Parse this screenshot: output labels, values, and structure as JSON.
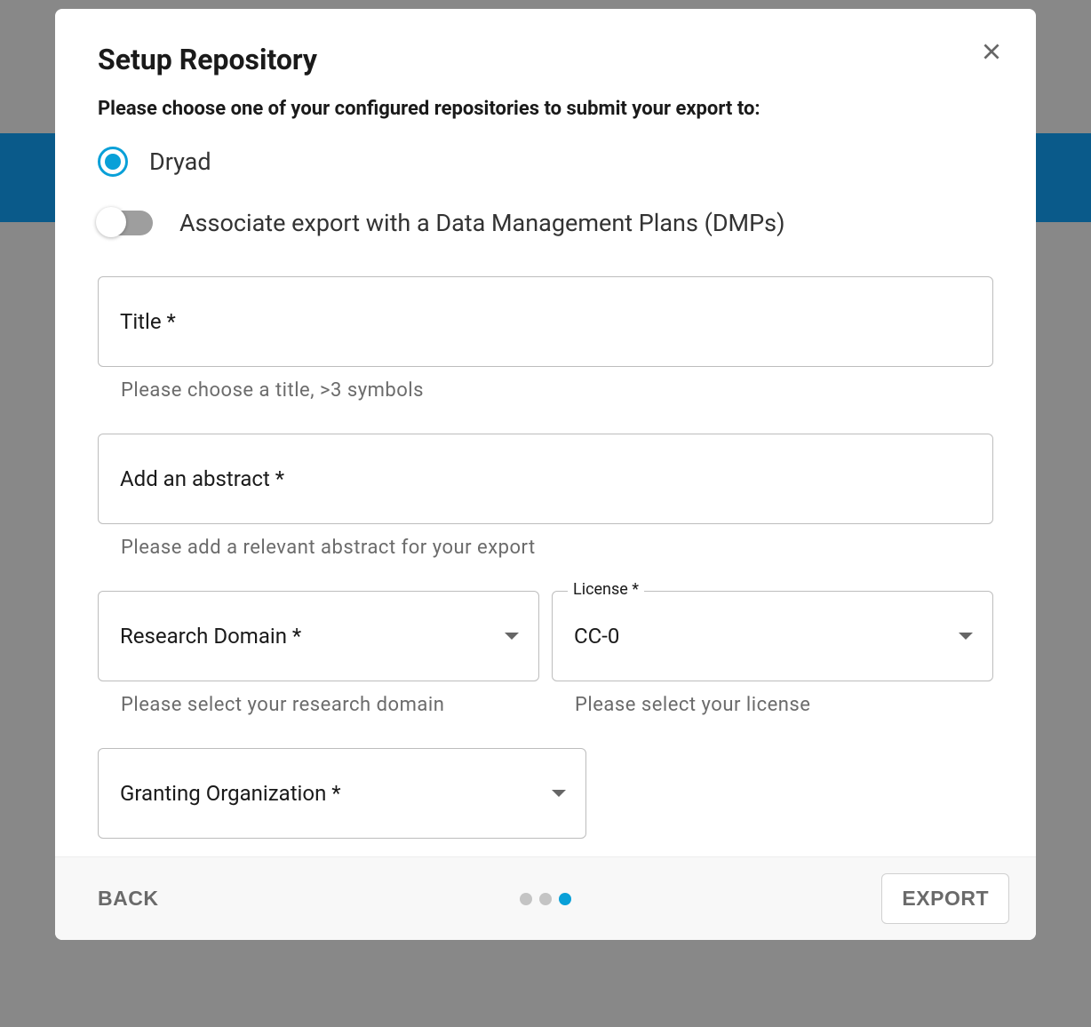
{
  "modal": {
    "title": "Setup Repository",
    "instruction": "Please choose one of your configured repositories to submit your export to:",
    "repository": {
      "selected": "Dryad"
    },
    "dmp_toggle": {
      "label": "Associate export with a Data Management Plans (DMPs)",
      "enabled": false
    },
    "fields": {
      "title": {
        "placeholder": "Title *",
        "value": "",
        "helper": "Please choose a title, >3 symbols"
      },
      "abstract": {
        "placeholder": "Add an abstract *",
        "value": "",
        "helper": "Please add a relevant abstract for your export"
      },
      "research_domain": {
        "label": "Research Domain *",
        "value": "",
        "helper": "Please select your research domain"
      },
      "license": {
        "floating_label": "License *",
        "value": "CC-0",
        "helper": "Please select your license"
      },
      "granting_org": {
        "label": "Granting Organization *",
        "value": ""
      }
    },
    "footer": {
      "back_label": "BACK",
      "export_label": "EXPORT",
      "step_count": 3,
      "active_step": 2
    }
  }
}
